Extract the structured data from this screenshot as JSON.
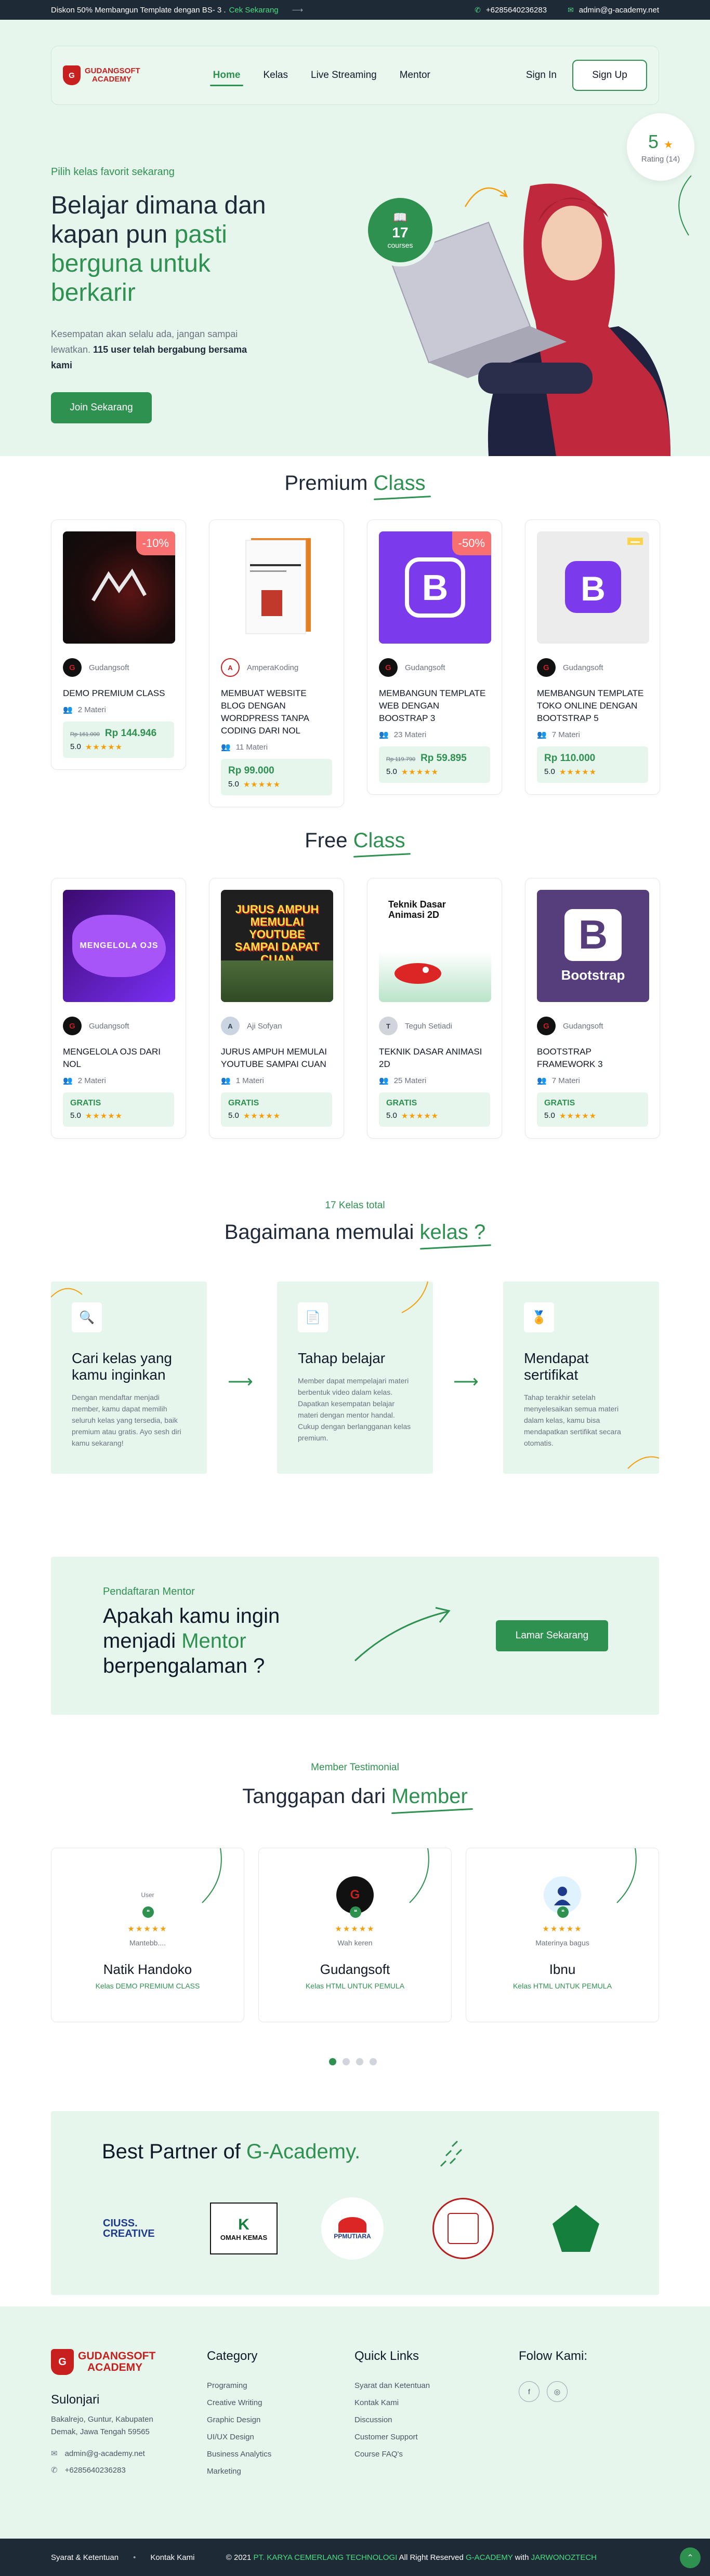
{
  "topbar": {
    "promo": "Diskon 50% Membangun Template dengan BS- 3 .",
    "promo_link": "Cek Sekarang",
    "phone": "+6285640236283",
    "email": "admin@g-academy.net"
  },
  "nav": {
    "logo_line1": "GUDANGSOFT",
    "logo_line2": "ACADEMY",
    "logo_mark": "G",
    "items": [
      "Home",
      "Kelas",
      "Live Streaming",
      "Mentor"
    ],
    "signin": "Sign In",
    "signup": "Sign Up"
  },
  "hero": {
    "subtitle": "Pilih kelas favorit sekarang",
    "title_a": "Belajar dimana dan kapan pun ",
    "title_b": "pasti berguna untuk berkarir",
    "desc_a": "Kesempatan akan selalu ada, jangan sampai lewatkan. ",
    "desc_b": "115 user telah bergabung bersama kami",
    "cta": "Join Sekarang",
    "courses_count": "17",
    "courses_label": "courses",
    "rating_value": "5",
    "rating_label": "Rating (14)"
  },
  "premium": {
    "title_a": "Premium ",
    "title_b": "Class",
    "cards": [
      {
        "discount": "-10%",
        "author": "Gudangsoft",
        "title": "DEMO PREMIUM CLASS",
        "materi": "2 Materi",
        "old_price": "Rp 161.000",
        "price": "Rp 144.946",
        "rating": "5.0"
      },
      {
        "discount": "",
        "author": "AmperaKoding",
        "title": "MEMBUAT WEBSITE BLOG DENGAN WORDPRESS TANPA CODING DARI NOL",
        "materi": "11 Materi",
        "old_price": "",
        "price": "Rp 99.000",
        "rating": "5.0"
      },
      {
        "discount": "-50%",
        "author": "Gudangsoft",
        "title": "MEMBANGUN TEMPLATE WEB DENGAN BOOSTRAP 3",
        "materi": "23 Materi",
        "old_price": "Rp 119.790",
        "price": "Rp 59.895",
        "rating": "5.0"
      },
      {
        "discount": "",
        "author": "Gudangsoft",
        "title": "MEMBANGUN TEMPLATE TOKO ONLINE DENGAN BOOTSTRAP 5",
        "materi": "7 Materi",
        "old_price": "",
        "price": "Rp 110.000",
        "rating": "5.0"
      }
    ]
  },
  "free": {
    "title_a": "Free ",
    "title_b": "Class",
    "cards": [
      {
        "author": "Gudangsoft",
        "title": "MENGELOLA OJS DARI NOL",
        "materi": "2 Materi",
        "price": "GRATIS",
        "rating": "5.0"
      },
      {
        "author": "Aji Sofyan",
        "title": "JURUS AMPUH MEMULAI YOUTUBE SAMPAI CUAN",
        "materi": "1 Materi",
        "price": "GRATIS",
        "rating": "5.0"
      },
      {
        "author": "Teguh Setiadi",
        "title": "TEKNIK DASAR ANIMASI 2D",
        "materi": "25 Materi",
        "price": "GRATIS",
        "rating": "5.0"
      },
      {
        "author": "Gudangsoft",
        "title": "BOOTSTRAP FRAMEWORK 3",
        "materi": "7 Materi",
        "price": "GRATIS",
        "rating": "5.0"
      }
    ],
    "thumb_texts": [
      "MENGELOLA OJS",
      "JURUS AMPUH MEMULAI YOUTUBE SAMPAI DAPAT CUAN",
      "Teknik Dasar Animasi 2D",
      "Bootstrap"
    ]
  },
  "how": {
    "total": "17 Kelas total",
    "title_a": "Bagaimana memulai ",
    "title_b": "kelas ?",
    "steps": [
      {
        "title": "Cari kelas yang kamu inginkan",
        "desc": "Dengan mendaftar menjadi member, kamu dapat memilih seluruh kelas yang tersedia, baik premium atau gratis. Ayo sesh diri kamu sekarang!"
      },
      {
        "title": "Tahap belajar",
        "desc": "Member dapat mempelajari materi berbentuk video dalam kelas. Dapatkan kesempatan belajar materi dengan mentor handal. Cukup dengan berlangganan kelas premium."
      },
      {
        "title": "Mendapat sertifikat",
        "desc": "Tahap terakhir setelah menyelesaikan semua materi dalam kelas, kamu bisa mendapatkan sertifikat secara otomatis."
      }
    ]
  },
  "mentor": {
    "label": "Pendaftaran Mentor",
    "title_a": "Apakah kamu ingin menjadi ",
    "title_b": "Mentor",
    "title_c": " berpengalaman ?",
    "cta": "Lamar Sekarang"
  },
  "testimonial": {
    "label": "Member Testimonial",
    "title_a": "Tanggapan dari ",
    "title_b": "Member",
    "items": [
      {
        "quote": "Mantebb....",
        "name": "Natik Handoko",
        "class": "Kelas DEMO PREMIUM CLASS",
        "img_alt": "User"
      },
      {
        "quote": "Wah keren",
        "name": "Gudangsoft",
        "class": "Kelas HTML UNTUK PEMULA",
        "img_alt": ""
      },
      {
        "quote": "Materinya bagus",
        "name": "Ibnu",
        "class": "Kelas HTML UNTUK PEMULA",
        "img_alt": ""
      }
    ]
  },
  "partners": {
    "title_a": "Best Partner of ",
    "title_b": "G-Academy.",
    "logos": [
      "CIUSS. CREATIVE",
      "OMAH KEMAS",
      "PPMUTIARA",
      "",
      ""
    ]
  },
  "footer": {
    "city": "Sulonjari",
    "address": "Bakalrejo, Guntur, Kabupaten Demak, Jawa Tengah 59565",
    "email": "admin@g-academy.net",
    "phone": "+6285640236283",
    "category_title": "Category",
    "categories": [
      "Programing",
      "Creative Writing",
      "Graphic Design",
      "UI/UX Design",
      "Business Analytics",
      "Marketing"
    ],
    "links_title": "Quick Links",
    "links": [
      "Syarat dan Ketentuan",
      "Kontak Kami",
      "Discussion",
      "Customer Support",
      "Course FAQ's"
    ],
    "follow_title": "Folow Kami:"
  },
  "bottombar": {
    "left": [
      "Syarat & Ketentuan",
      "Kontak Kami"
    ],
    "copy_a": "© 2021 ",
    "copy_b": "PT. KARYA CEMERLANG TECHNOLOGI",
    "copy_c": " All Right Reserved ",
    "copy_d": "G-ACADEMY",
    "copy_e": " with ",
    "copy_f": "JARWONOZTECH"
  }
}
